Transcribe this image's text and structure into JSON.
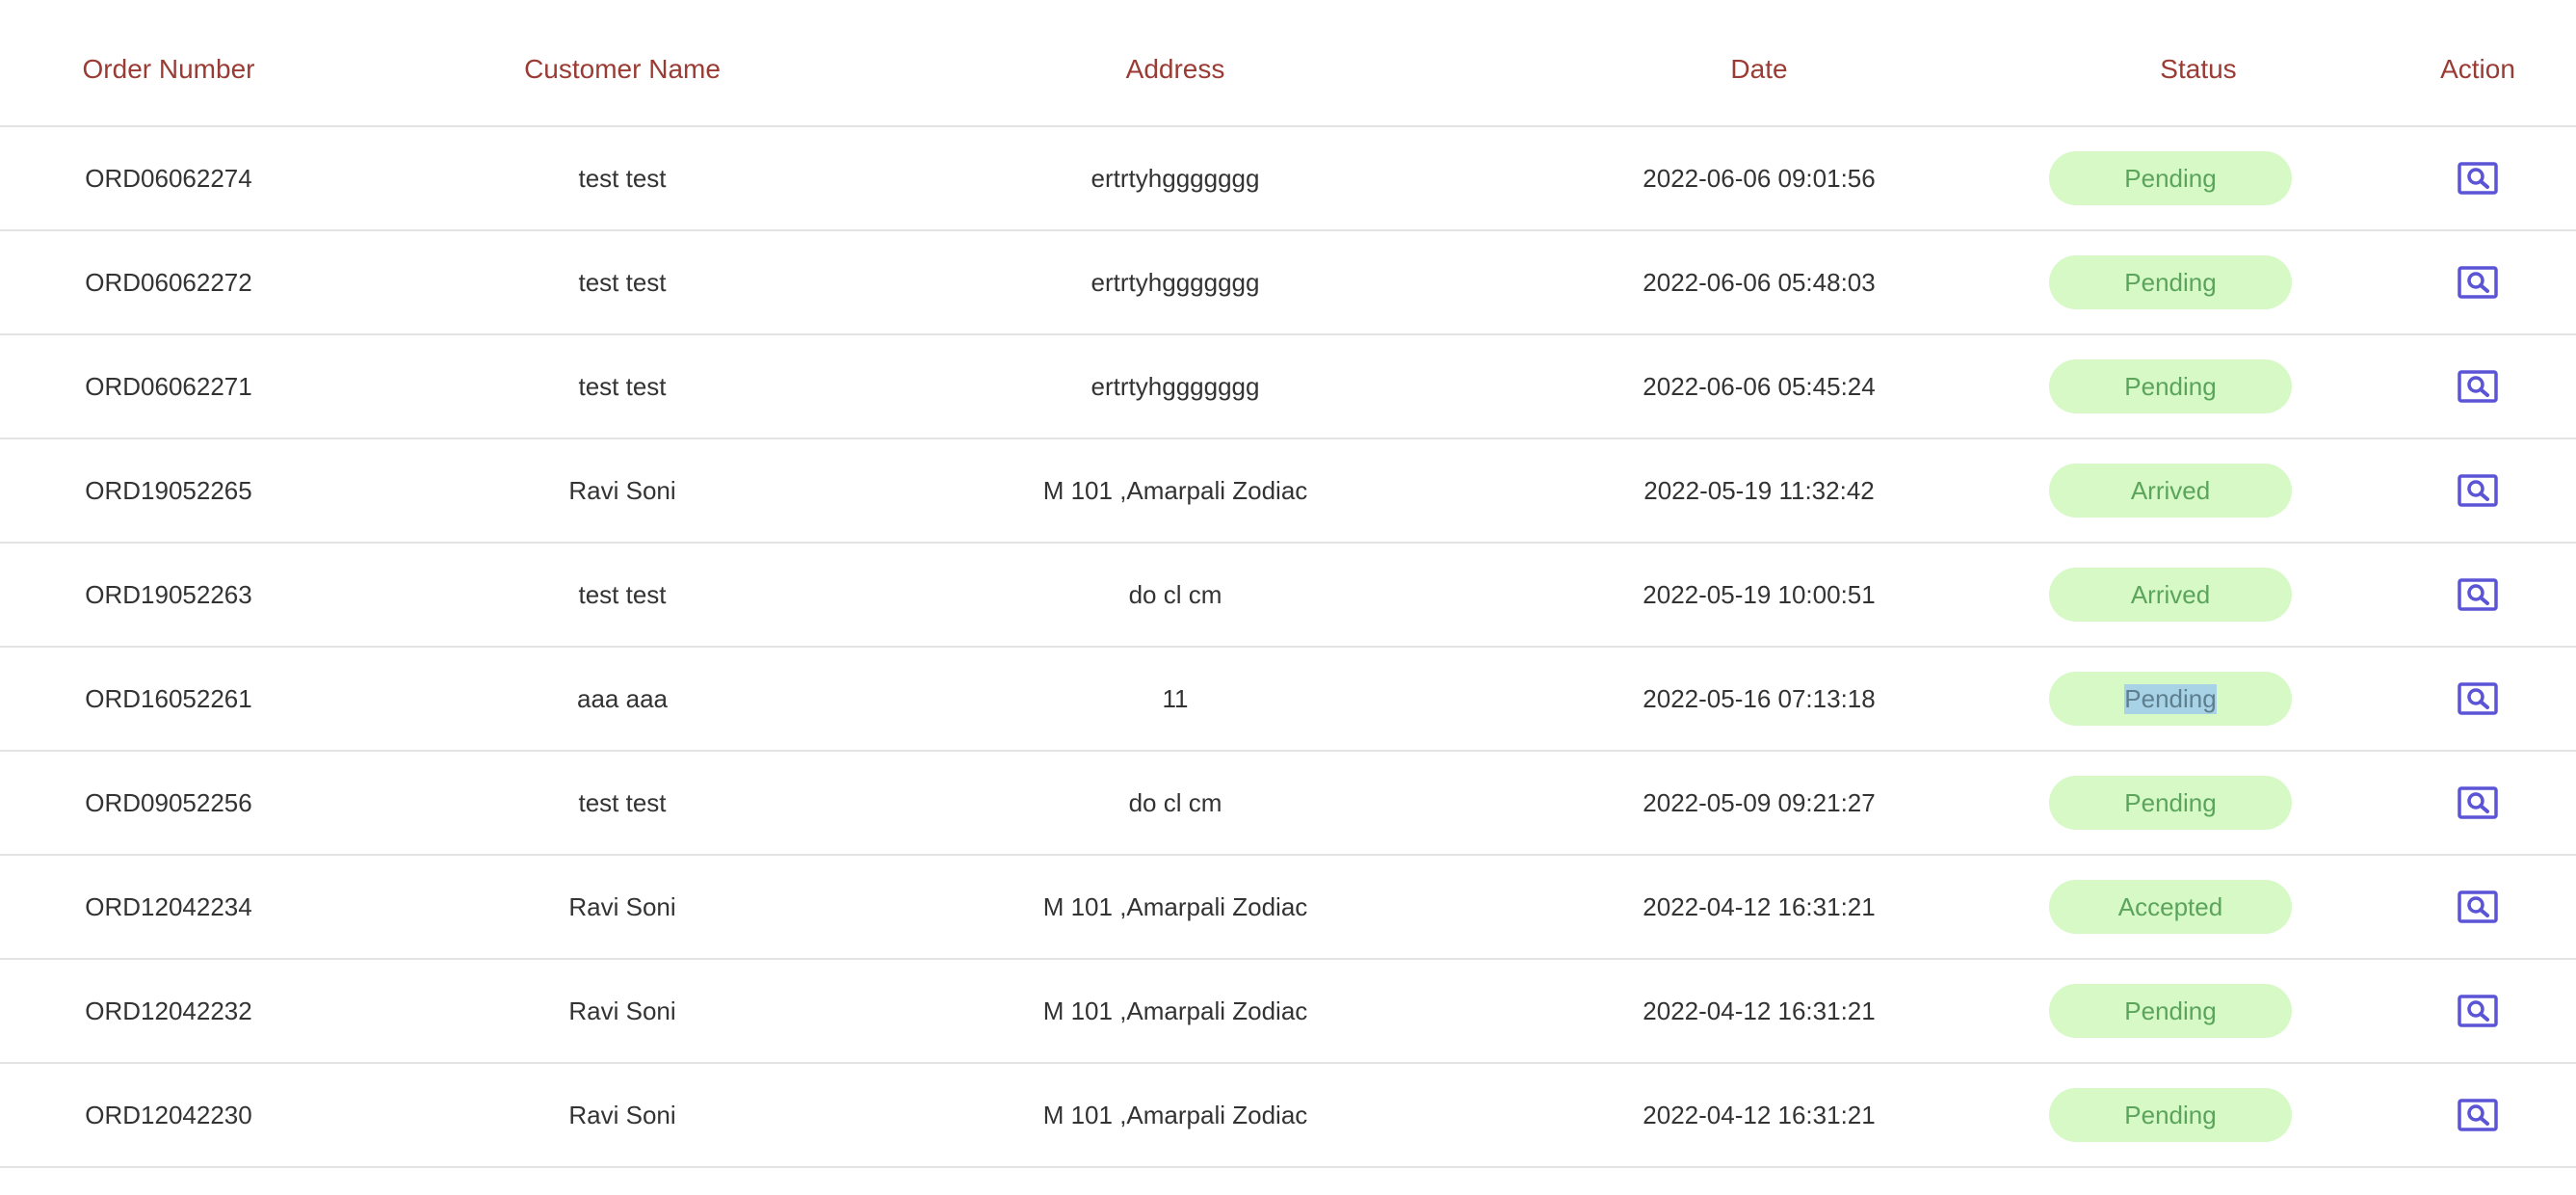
{
  "table": {
    "headers": {
      "order_number": "Order Number",
      "customer_name": "Customer Name",
      "address": "Address",
      "date": "Date",
      "status": "Status",
      "action": "Action"
    },
    "rows": [
      {
        "order_number": "ORD06062274",
        "customer_name": "test test",
        "address": "ertrtyhggggggg",
        "date": "2022-06-06 09:01:56",
        "status": "Pending",
        "selected_text": false,
        "action_icon": "view-order-icon"
      },
      {
        "order_number": "ORD06062272",
        "customer_name": "test test",
        "address": "ertrtyhggggggg",
        "date": "2022-06-06 05:48:03",
        "status": "Pending",
        "selected_text": false,
        "action_icon": "view-order-icon"
      },
      {
        "order_number": "ORD06062271",
        "customer_name": "test test",
        "address": "ertrtyhggggggg",
        "date": "2022-06-06 05:45:24",
        "status": "Pending",
        "selected_text": false,
        "action_icon": "view-order-icon"
      },
      {
        "order_number": "ORD19052265",
        "customer_name": "Ravi Soni",
        "address": "M 101 ,Amarpali Zodiac",
        "date": "2022-05-19 11:32:42",
        "status": "Arrived",
        "selected_text": false,
        "action_icon": "view-order-icon"
      },
      {
        "order_number": "ORD19052263",
        "customer_name": "test test",
        "address": "do cl cm",
        "date": "2022-05-19 10:00:51",
        "status": "Arrived",
        "selected_text": false,
        "action_icon": "view-order-icon"
      },
      {
        "order_number": "ORD16052261",
        "customer_name": "aaa aaa",
        "address": "11",
        "date": "2022-05-16 07:13:18",
        "status": "Pending",
        "selected_text": true,
        "action_icon": "view-order-icon"
      },
      {
        "order_number": "ORD09052256",
        "customer_name": "test test",
        "address": "do cl cm",
        "date": "2022-05-09 09:21:27",
        "status": "Pending",
        "selected_text": false,
        "action_icon": "view-order-icon"
      },
      {
        "order_number": "ORD12042234",
        "customer_name": "Ravi Soni",
        "address": "M 101 ,Amarpali Zodiac",
        "date": "2022-04-12 16:31:21",
        "status": "Accepted",
        "selected_text": false,
        "action_icon": "view-order-icon"
      },
      {
        "order_number": "ORD12042232",
        "customer_name": "Ravi Soni",
        "address": "M 101 ,Amarpali Zodiac",
        "date": "2022-04-12 16:31:21",
        "status": "Pending",
        "selected_text": false,
        "action_icon": "view-order-icon"
      },
      {
        "order_number": "ORD12042230",
        "customer_name": "Ravi Soni",
        "address": "M 101 ,Amarpali Zodiac",
        "date": "2022-04-12 16:31:21",
        "status": "Pending",
        "selected_text": false,
        "action_icon": "view-order-icon"
      }
    ]
  },
  "colors": {
    "header_text": "#9a3b34",
    "cell_text": "#333333",
    "row_divider": "#e3e3e3",
    "status_badge_bg": "#d6f9c6",
    "status_badge_text": "#5ba45b",
    "action_icon": "#5b54d6",
    "text_selection": "#a8d3e6"
  }
}
